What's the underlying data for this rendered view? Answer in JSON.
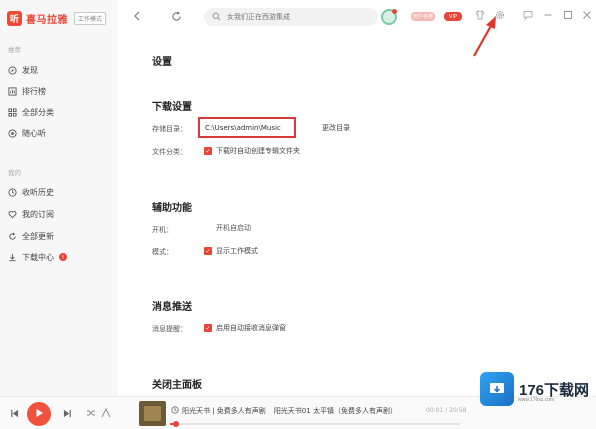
{
  "app": {
    "logo_char": "听",
    "logo_name": "喜马拉雅",
    "mode_badge": "工作模式"
  },
  "sidebar": {
    "section_recommend": "推荐",
    "recommend_items": [
      {
        "label": "发现",
        "icon": "compass-icon"
      },
      {
        "label": "排行榜",
        "icon": "chart-icon"
      },
      {
        "label": "全部分类",
        "icon": "grid-icon"
      },
      {
        "label": "随心听",
        "icon": "radio-icon"
      }
    ],
    "section_mine": "我的",
    "mine_items": [
      {
        "label": "收听历史",
        "icon": "clock-icon"
      },
      {
        "label": "我的订阅",
        "icon": "heart-icon"
      },
      {
        "label": "全部更新",
        "icon": "refresh-icon"
      },
      {
        "label": "下载中心",
        "icon": "download-icon",
        "badge": "!"
      }
    ]
  },
  "topbar": {
    "search_placeholder": "女我们正在西游集成",
    "user_tag": "用户名称",
    "vip_tag": "VIP"
  },
  "settings": {
    "title": "设置",
    "download": {
      "heading": "下载设置",
      "dir_label": "存储目录：",
      "dir_value": "C:\\Users\\admin\\Music",
      "change_dir": "更改目录",
      "classify_label": "文件分类：",
      "classify_option": "下载时自动创建专辑文件夹"
    },
    "assist": {
      "heading": "辅助功能",
      "startup_label": "开机：",
      "startup_value": "开机自启动",
      "mode_label": "模式：",
      "mode_option": "显示工作模式"
    },
    "push": {
      "heading": "消息推送",
      "notice_label": "消息提醒：",
      "notice_option": "启用自动接收消息弹窗"
    },
    "close_panel": {
      "heading": "关闭主面板"
    }
  },
  "player": {
    "track_title": "阳光天书 | 免费多人有声剧",
    "track_sub": "阳光天书01 太平镇（免费多人有声剧）",
    "time": "00:01 / 20:58",
    "progress": 0.02
  },
  "watermark": {
    "brand": "176下载网",
    "url": "www.176xz.com"
  }
}
